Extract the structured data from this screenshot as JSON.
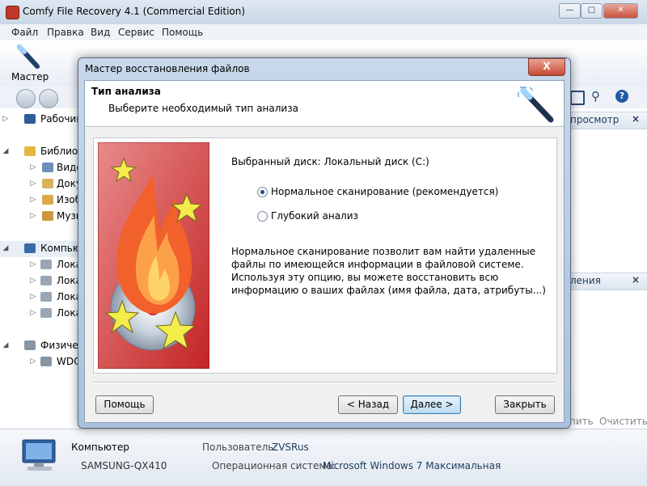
{
  "app": {
    "title": "Comfy File Recovery 4.1 (Commercial Edition)"
  },
  "menu": [
    "Файл",
    "Правка",
    "Вид",
    "Сервис",
    "Помощь"
  ],
  "toolbar": {
    "wizard_label": "Мастер"
  },
  "tree": {
    "desktop": "Рабочий стол",
    "libraries": "Библиотеки",
    "videos": "Видео",
    "documents": "Документы",
    "images": "Изображения",
    "music": "Музыка",
    "computer": "Компьютер",
    "local1": "Локальный диск",
    "local2": "Локальный диск",
    "local3": "Локальный диск",
    "local4": "Локальный диск",
    "physical": "Физические диски",
    "wdc": "WDC"
  },
  "right_pane": {
    "preview_header": "просмотр",
    "restore_header": "ления",
    "restore_button_partial": "пить",
    "clear_button": "Очистить"
  },
  "status": {
    "computer_label": "Компьютер",
    "computer_name": "SAMSUNG-QX410",
    "user_label": "Пользователь:",
    "user_value": "ZVSRus",
    "os_label": "Операционная система:",
    "os_value": "Microsoft Windows 7 Максимальная"
  },
  "dialog": {
    "title": "Мастер восстановления файлов",
    "close_glyph": "X",
    "heading": "Тип анализа",
    "subheading": "Выберите необходимый тип анализа",
    "selected_disk": "Выбранный диск: Локальный диск (C:)",
    "options": [
      {
        "label": "Нормальное сканирование (рекомендуется)",
        "selected": true
      },
      {
        "label": "Глубокий анализ",
        "selected": false
      }
    ],
    "description": "Нормальное сканирование позволит вам найти удаленные файлы по имеющейся информации в файловой системе. Используя эту опцию, вы можете восстановить всю информацию о ваших файлах (имя файла, дата, атрибуты...)",
    "buttons": {
      "help": "Помощь",
      "back": "< Назад",
      "next": "Далее >",
      "close": "Закрыть"
    }
  },
  "colors": {
    "accent": "#3c7fb1",
    "art_red": "#cc2e2e",
    "title_blue": "#1e3a5f"
  }
}
